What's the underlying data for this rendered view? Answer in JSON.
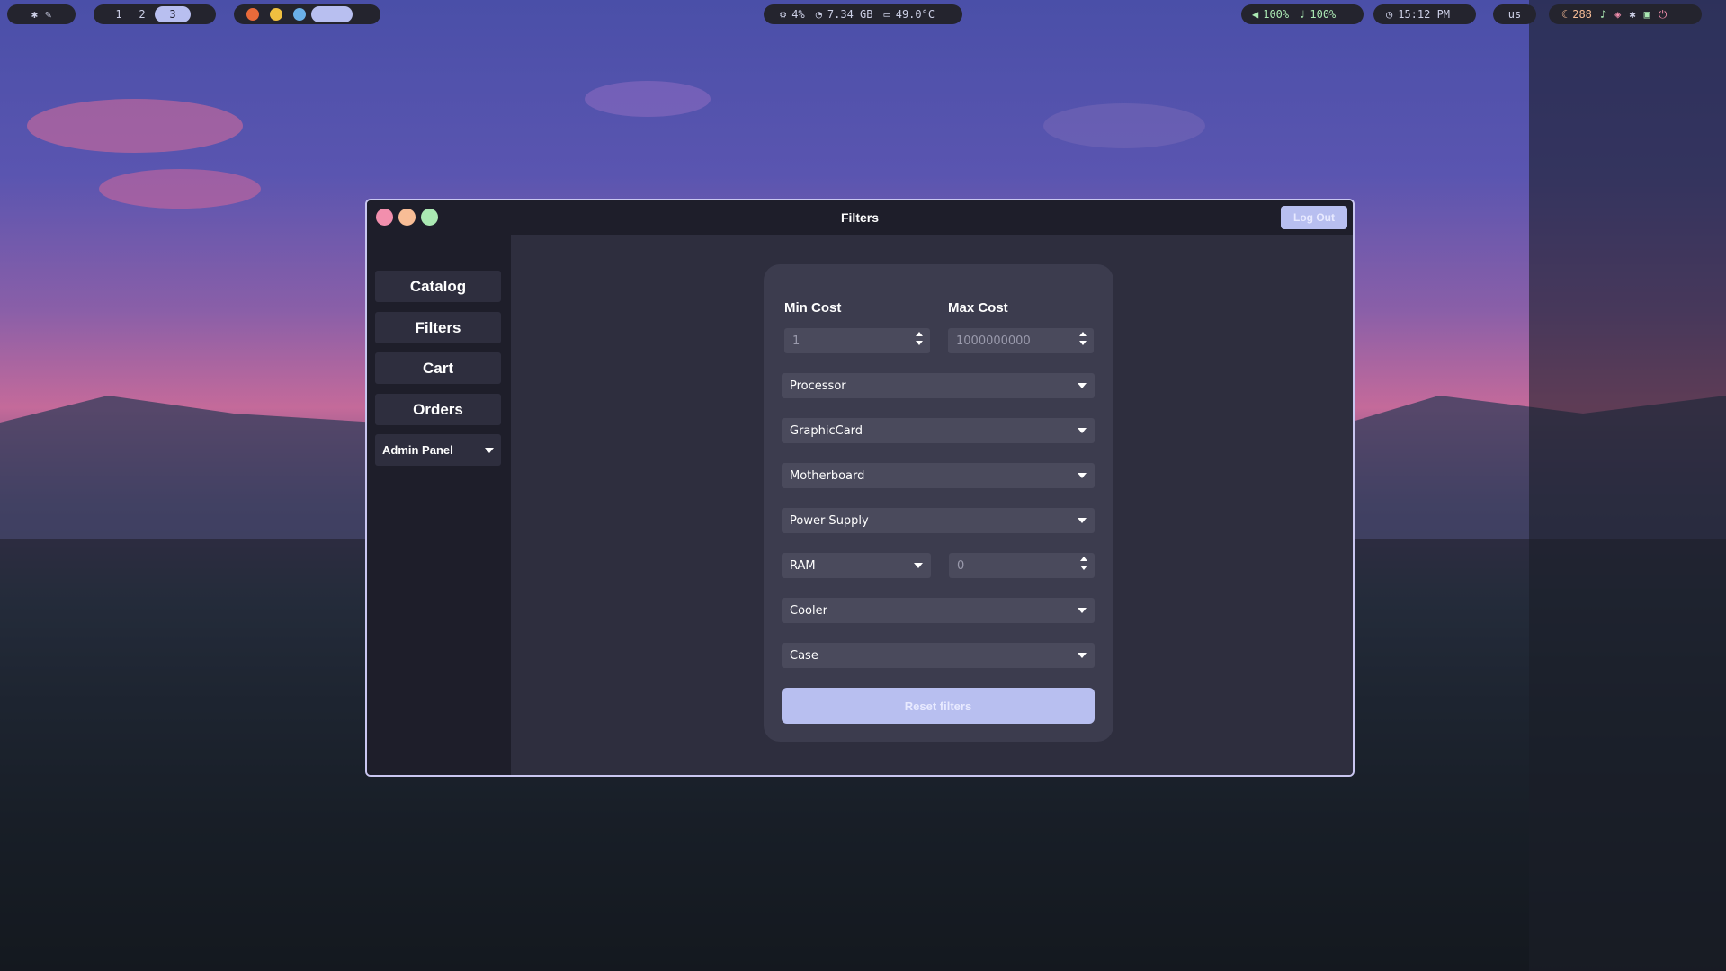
{
  "topbar": {
    "workspaces": [
      "1",
      "2",
      "3"
    ],
    "active_workspace": "3",
    "system_stats": {
      "cpu": "4%",
      "memory": "7.34 GB",
      "temperature": "49.0°C"
    },
    "audio": {
      "volume": "100%",
      "mic": "100%"
    },
    "clock": "15:12 PM",
    "keyboard_layout": "us",
    "updates": "288"
  },
  "window": {
    "title": "Filters",
    "logout_label": "Log Out",
    "traffic_colors": [
      "#f28fad",
      "#f8bd96",
      "#abe9b3"
    ]
  },
  "sidebar": {
    "items": [
      {
        "label": "Catalog"
      },
      {
        "label": "Filters"
      },
      {
        "label": "Cart"
      },
      {
        "label": "Orders"
      }
    ],
    "admin_label": "Admin Panel"
  },
  "filters": {
    "min_cost_label": "Min Cost",
    "max_cost_label": "Max Cost",
    "min_cost_value": "1",
    "max_cost_value": "1000000000",
    "selects": [
      "Processor",
      "GraphicCard",
      "Motherboard",
      "Power Supply"
    ],
    "ram_label": "RAM",
    "ram_value": "0",
    "selects_after": [
      "Cooler",
      "Case"
    ],
    "reset_label": "Reset filters"
  },
  "colors": {
    "accent": "#b8bff0",
    "panel": "#3c3c4e",
    "background": "#2e2e3e"
  }
}
